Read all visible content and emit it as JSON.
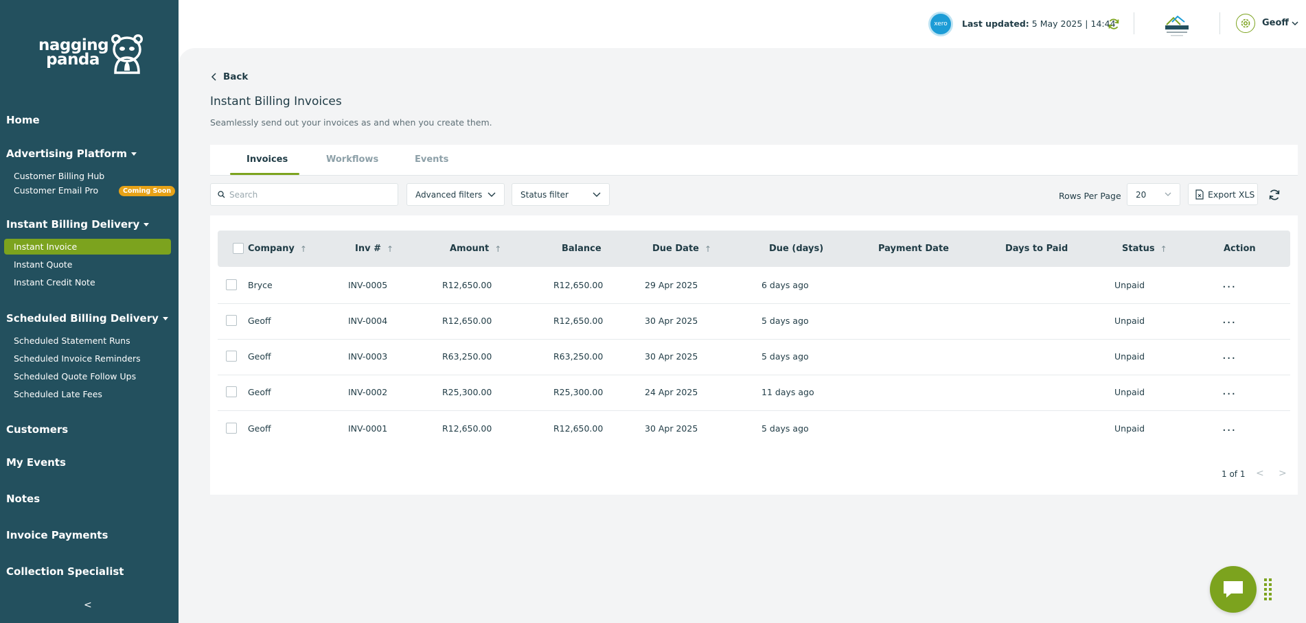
{
  "brand": {
    "logo_line1": "nagging",
    "logo_line2": "panda"
  },
  "sidebar": {
    "home": "Home",
    "advertising": {
      "label": "Advertising Platform",
      "items": [
        "Customer Billing Hub",
        "Customer Email Pro"
      ],
      "badge": "Coming Soon"
    },
    "instant": {
      "label": "Instant Billing Delivery",
      "items": [
        "Instant Invoice",
        "Instant Quote",
        "Instant Credit Note"
      ]
    },
    "scheduled": {
      "label": "Scheduled Billing Delivery",
      "items": [
        "Scheduled Statement Runs",
        "Scheduled Invoice Reminders",
        "Scheduled Quote Follow Ups",
        "Scheduled Late Fees"
      ]
    },
    "customers": "Customers",
    "my_events": "My Events",
    "notes": "Notes",
    "invoice_payments": "Invoice Payments",
    "collection_specialist": "Collection Specialist",
    "collapse": "<"
  },
  "topbar": {
    "xero_label": "xero",
    "last_updated_label": "Last updated:",
    "last_updated_value": "5 May 2025 | 14:44",
    "user_name": "Geoff"
  },
  "page": {
    "back": "Back",
    "title": "Instant Billing Invoices",
    "subtitle": "Seamlessly send out your invoices as and when you create them."
  },
  "tabs": [
    "Invoices",
    "Workflows",
    "Events"
  ],
  "toolbar": {
    "search_placeholder": "Search",
    "advanced_filters": "Advanced filters",
    "status_filter": "Status filter",
    "rows_per_page_label": "Rows Per Page",
    "rows_per_page_value": "20",
    "export": "Export XLS"
  },
  "table": {
    "columns": [
      "Company",
      "Inv #",
      "Amount",
      "Balance",
      "Due Date",
      "Due (days)",
      "Payment Date",
      "Days to Paid",
      "Status",
      "Action"
    ],
    "rows": [
      {
        "company": "Bryce",
        "inv": "INV-0005",
        "amount": "R12,650.00",
        "balance": "R12,650.00",
        "due_date": "29 Apr 2025",
        "due_days": "6 days ago",
        "status": "Unpaid"
      },
      {
        "company": "Geoff",
        "inv": "INV-0004",
        "amount": "R12,650.00",
        "balance": "R12,650.00",
        "due_date": "30 Apr 2025",
        "due_days": "5 days ago",
        "status": "Unpaid"
      },
      {
        "company": "Geoff",
        "inv": "INV-0003",
        "amount": "R63,250.00",
        "balance": "R63,250.00",
        "due_date": "30 Apr 2025",
        "due_days": "5 days ago",
        "status": "Unpaid"
      },
      {
        "company": "Geoff",
        "inv": "INV-0002",
        "amount": "R25,300.00",
        "balance": "R25,300.00",
        "due_date": "24 Apr 2025",
        "due_days": "11 days ago",
        "status": "Unpaid"
      },
      {
        "company": "Geoff",
        "inv": "INV-0001",
        "amount": "R12,650.00",
        "balance": "R12,650.00",
        "due_date": "30 Apr 2025",
        "due_days": "5 days ago",
        "status": "Unpaid"
      }
    ],
    "action_label": "..."
  },
  "pagination": {
    "text": "1 of 1",
    "prev": "<",
    "next": ">"
  },
  "colors": {
    "sidebar_bg": "#23505e",
    "accent": "#7ca31e",
    "badge": "#e7a217",
    "xero": "#1c9cd6"
  }
}
